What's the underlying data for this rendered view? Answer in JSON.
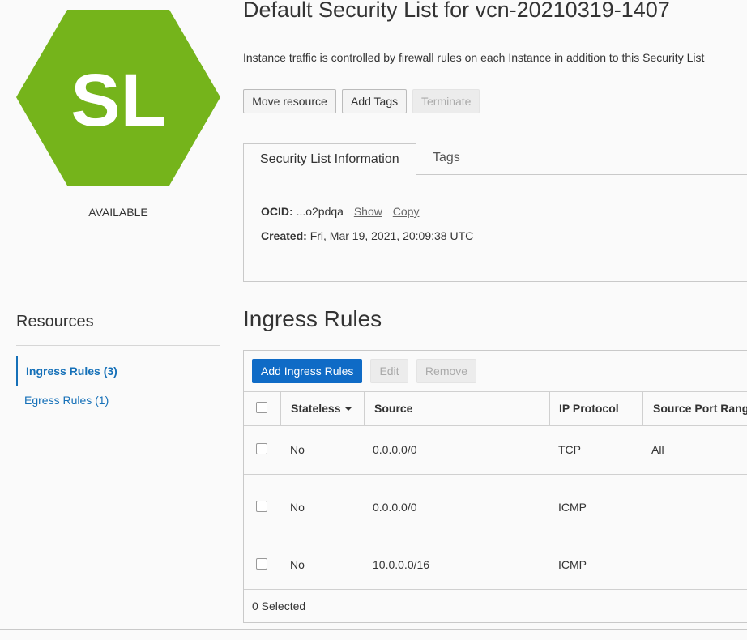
{
  "badge": {
    "initials": "SL",
    "color": "#75b41b",
    "status": "AVAILABLE"
  },
  "header": {
    "title": "Default Security List for vcn-20210319-1407",
    "description": "Instance traffic is controlled by firewall rules on each Instance in addition to this Security List",
    "actions": {
      "move": "Move resource",
      "add_tags": "Add Tags",
      "terminate": "Terminate"
    }
  },
  "tabs": {
    "info": "Security List Information",
    "tags": "Tags"
  },
  "info": {
    "ocid_label": "OCID:",
    "ocid_value": "...o2pdqa",
    "show": "Show",
    "copy": "Copy",
    "created_label": "Created:",
    "created_value": "Fri, Mar 19, 2021, 20:09:38 UTC"
  },
  "resources": {
    "title": "Resources",
    "items": [
      {
        "label": "Ingress Rules (3)",
        "active": true
      },
      {
        "label": "Egress Rules (1)",
        "active": false
      }
    ]
  },
  "ingress": {
    "title": "Ingress Rules",
    "buttons": {
      "add": "Add Ingress Rules",
      "edit": "Edit",
      "remove": "Remove"
    },
    "columns": [
      "Stateless",
      "Source",
      "IP Protocol",
      "Source Port Rang"
    ],
    "rows": [
      {
        "stateless": "No",
        "source": "0.0.0.0/0",
        "protocol": "TCP",
        "port": "All"
      },
      {
        "stateless": "No",
        "source": "0.0.0.0/0",
        "protocol": "ICMP",
        "port": ""
      },
      {
        "stateless": "No",
        "source": "10.0.0.0/16",
        "protocol": "ICMP",
        "port": ""
      }
    ],
    "footer": "0 Selected"
  },
  "colors": {
    "accent": "#0f6bc6",
    "link": "#1570b8"
  }
}
